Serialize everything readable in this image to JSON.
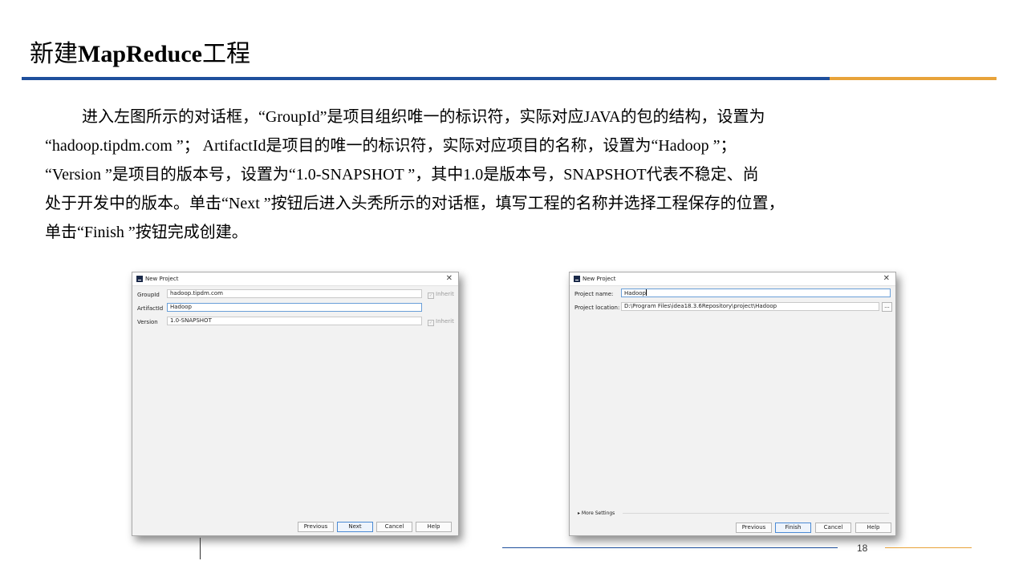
{
  "slide": {
    "title_cn_1": "新建",
    "title_en": "MapReduce",
    "title_cn_2": "工程",
    "paragraph_lines": [
      "进入左图所示的对话框，“GroupId”是项目组织唯一的标识符，实际对应JAVA的包的结构，设置为",
      "“hadoop.tipdm.com ”； ArtifactId是项目的唯一的标识符，实际对应项目的名称，设置为“Hadoop ”；",
      "“Version ”是项目的版本号，设置为“1.0-SNAPSHOT ”，其中1.0是版本号，SNAPSHOT代表不稳定、尚",
      "处于开发中的版本。单击“Next ”按钮后进入头秃所示的对话框，填写工程的名称并选择工程保存的位置，",
      "单击“Finish ”按钮完成创建。"
    ],
    "page_number": "18",
    "colors": {
      "accent_blue": "#1e4f9c",
      "accent_orange": "#e8a33a"
    }
  },
  "dialog1": {
    "title": "New Project",
    "close_icon": "close-icon",
    "fields": [
      {
        "label": "GroupId",
        "value": "hadoop.tipdm.com",
        "inherit": "Inherit"
      },
      {
        "label": "ArtifactId",
        "value": "Hadoop"
      },
      {
        "label": "Version",
        "value": "1.0-SNAPSHOT",
        "inherit": "Inherit"
      }
    ],
    "buttons": {
      "previous": "Previous",
      "next": "Next",
      "cancel": "Cancel",
      "help": "Help"
    }
  },
  "dialog2": {
    "title": "New Project",
    "project_name_label": "Project name:",
    "project_name_value": "Hadoop",
    "project_location_label": "Project location:",
    "project_location_value": "D:\\Program Files\\idea18.3.6Repository\\project\\Hadoop",
    "browse_label": "...",
    "more_settings": "More Settings",
    "buttons": {
      "previous": "Previous",
      "finish": "Finish",
      "cancel": "Cancel",
      "help": "Help"
    }
  }
}
